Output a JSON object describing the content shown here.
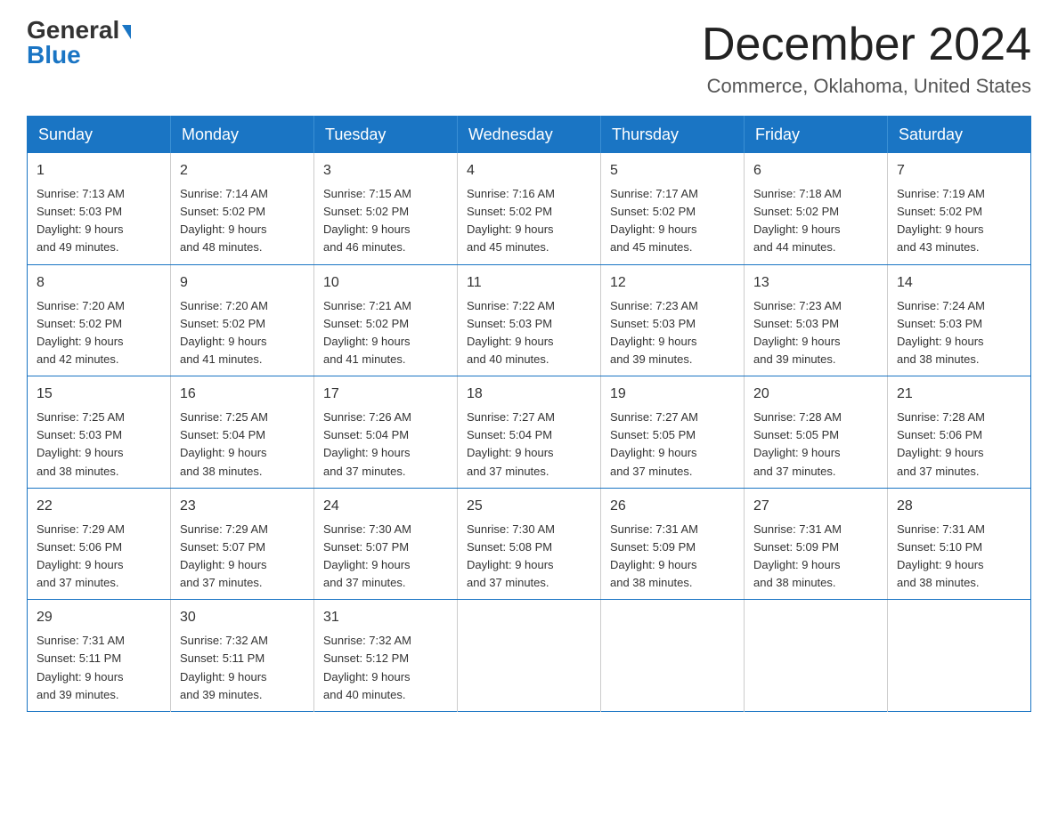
{
  "logo": {
    "general": "General",
    "blue": "Blue"
  },
  "header": {
    "month_title": "December 2024",
    "location": "Commerce, Oklahoma, United States"
  },
  "weekdays": [
    "Sunday",
    "Monday",
    "Tuesday",
    "Wednesday",
    "Thursday",
    "Friday",
    "Saturday"
  ],
  "weeks": [
    [
      {
        "day": "1",
        "sunrise": "7:13 AM",
        "sunset": "5:03 PM",
        "daylight": "9 hours and 49 minutes."
      },
      {
        "day": "2",
        "sunrise": "7:14 AM",
        "sunset": "5:02 PM",
        "daylight": "9 hours and 48 minutes."
      },
      {
        "day": "3",
        "sunrise": "7:15 AM",
        "sunset": "5:02 PM",
        "daylight": "9 hours and 46 minutes."
      },
      {
        "day": "4",
        "sunrise": "7:16 AM",
        "sunset": "5:02 PM",
        "daylight": "9 hours and 45 minutes."
      },
      {
        "day": "5",
        "sunrise": "7:17 AM",
        "sunset": "5:02 PM",
        "daylight": "9 hours and 45 minutes."
      },
      {
        "day": "6",
        "sunrise": "7:18 AM",
        "sunset": "5:02 PM",
        "daylight": "9 hours and 44 minutes."
      },
      {
        "day": "7",
        "sunrise": "7:19 AM",
        "sunset": "5:02 PM",
        "daylight": "9 hours and 43 minutes."
      }
    ],
    [
      {
        "day": "8",
        "sunrise": "7:20 AM",
        "sunset": "5:02 PM",
        "daylight": "9 hours and 42 minutes."
      },
      {
        "day": "9",
        "sunrise": "7:20 AM",
        "sunset": "5:02 PM",
        "daylight": "9 hours and 41 minutes."
      },
      {
        "day": "10",
        "sunrise": "7:21 AM",
        "sunset": "5:02 PM",
        "daylight": "9 hours and 41 minutes."
      },
      {
        "day": "11",
        "sunrise": "7:22 AM",
        "sunset": "5:03 PM",
        "daylight": "9 hours and 40 minutes."
      },
      {
        "day": "12",
        "sunrise": "7:23 AM",
        "sunset": "5:03 PM",
        "daylight": "9 hours and 39 minutes."
      },
      {
        "day": "13",
        "sunrise": "7:23 AM",
        "sunset": "5:03 PM",
        "daylight": "9 hours and 39 minutes."
      },
      {
        "day": "14",
        "sunrise": "7:24 AM",
        "sunset": "5:03 PM",
        "daylight": "9 hours and 38 minutes."
      }
    ],
    [
      {
        "day": "15",
        "sunrise": "7:25 AM",
        "sunset": "5:03 PM",
        "daylight": "9 hours and 38 minutes."
      },
      {
        "day": "16",
        "sunrise": "7:25 AM",
        "sunset": "5:04 PM",
        "daylight": "9 hours and 38 minutes."
      },
      {
        "day": "17",
        "sunrise": "7:26 AM",
        "sunset": "5:04 PM",
        "daylight": "9 hours and 37 minutes."
      },
      {
        "day": "18",
        "sunrise": "7:27 AM",
        "sunset": "5:04 PM",
        "daylight": "9 hours and 37 minutes."
      },
      {
        "day": "19",
        "sunrise": "7:27 AM",
        "sunset": "5:05 PM",
        "daylight": "9 hours and 37 minutes."
      },
      {
        "day": "20",
        "sunrise": "7:28 AM",
        "sunset": "5:05 PM",
        "daylight": "9 hours and 37 minutes."
      },
      {
        "day": "21",
        "sunrise": "7:28 AM",
        "sunset": "5:06 PM",
        "daylight": "9 hours and 37 minutes."
      }
    ],
    [
      {
        "day": "22",
        "sunrise": "7:29 AM",
        "sunset": "5:06 PM",
        "daylight": "9 hours and 37 minutes."
      },
      {
        "day": "23",
        "sunrise": "7:29 AM",
        "sunset": "5:07 PM",
        "daylight": "9 hours and 37 minutes."
      },
      {
        "day": "24",
        "sunrise": "7:30 AM",
        "sunset": "5:07 PM",
        "daylight": "9 hours and 37 minutes."
      },
      {
        "day": "25",
        "sunrise": "7:30 AM",
        "sunset": "5:08 PM",
        "daylight": "9 hours and 37 minutes."
      },
      {
        "day": "26",
        "sunrise": "7:31 AM",
        "sunset": "5:09 PM",
        "daylight": "9 hours and 38 minutes."
      },
      {
        "day": "27",
        "sunrise": "7:31 AM",
        "sunset": "5:09 PM",
        "daylight": "9 hours and 38 minutes."
      },
      {
        "day": "28",
        "sunrise": "7:31 AM",
        "sunset": "5:10 PM",
        "daylight": "9 hours and 38 minutes."
      }
    ],
    [
      {
        "day": "29",
        "sunrise": "7:31 AM",
        "sunset": "5:11 PM",
        "daylight": "9 hours and 39 minutes."
      },
      {
        "day": "30",
        "sunrise": "7:32 AM",
        "sunset": "5:11 PM",
        "daylight": "9 hours and 39 minutes."
      },
      {
        "day": "31",
        "sunrise": "7:32 AM",
        "sunset": "5:12 PM",
        "daylight": "9 hours and 40 minutes."
      },
      null,
      null,
      null,
      null
    ]
  ],
  "labels": {
    "sunrise": "Sunrise: ",
    "sunset": "Sunset: ",
    "daylight": "Daylight: "
  }
}
